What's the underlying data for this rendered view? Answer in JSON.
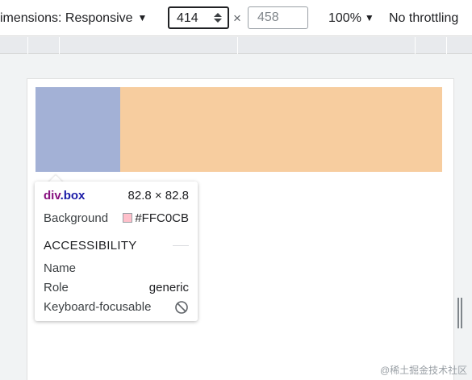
{
  "toolbar": {
    "dimensions_label": "imensions: Responsive",
    "width_value": "414",
    "times_symbol": "×",
    "height_value": "458",
    "zoom_label": "100%",
    "throttle_label": "No throttling",
    "caret_glyph": "▼"
  },
  "tooltip": {
    "element_tag": "div",
    "element_class": ".box",
    "size": "82.8 × 82.8",
    "background_label": "Background",
    "background_value": "#FFC0CB",
    "background_color": "#FFC0CB",
    "section_title": "ACCESSIBILITY",
    "name_label": "Name",
    "role_label": "Role",
    "role_value": "generic",
    "focusable_label": "Keyboard-focusable",
    "focusable_icon": "not-allowed-icon"
  },
  "colors": {
    "box_left": "#a3b1d6",
    "box_right": "#f7cd9f"
  },
  "watermark": "@稀土掘金技术社区"
}
